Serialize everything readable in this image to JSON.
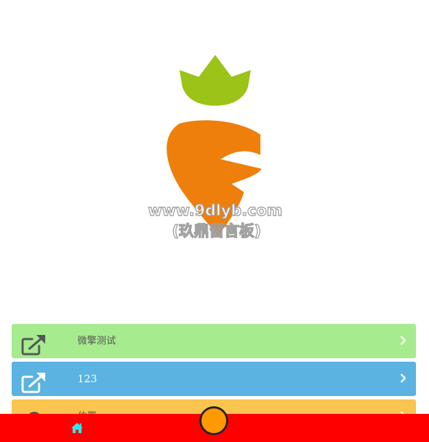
{
  "hero": {
    "watermark_line1": "www.9dlyb.com",
    "watermark_line2": "(玖鼎留言板)",
    "logo_icon": "carrot-logo"
  },
  "menu": {
    "items": [
      {
        "label": "微擎测试",
        "icon": "external-link-icon",
        "bg": "#a6eb8e",
        "text_color": "#555555"
      },
      {
        "label": "123",
        "icon": "external-link-icon",
        "bg": "#5ab3e0",
        "text_color": "#ffffff"
      },
      {
        "label": "位置",
        "icon": "location-icon",
        "bg": "#fac54e",
        "text_color": "#555555"
      }
    ]
  },
  "bottombar": {
    "bg": "#ff0000",
    "home_icon": "home-icon",
    "home_color": "#33e7ee",
    "center_button_color": "#ff9900"
  },
  "colors": {
    "carrot_top": "#9bc318",
    "carrot_body": "#ee7f0a"
  }
}
